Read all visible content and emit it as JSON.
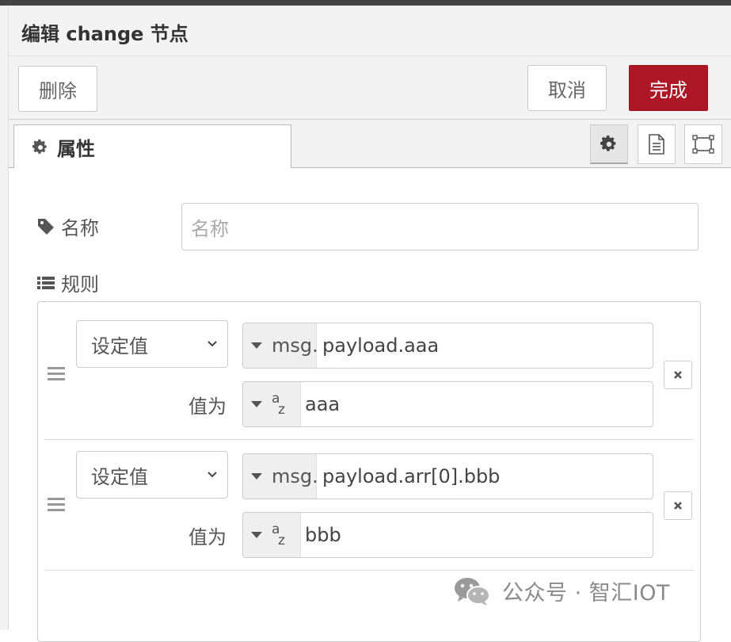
{
  "dialog": {
    "title": "编辑 change 节点"
  },
  "toolbar": {
    "delete_label": "删除",
    "cancel_label": "取消",
    "done_label": "完成"
  },
  "tabs": {
    "properties_label": "属性"
  },
  "form": {
    "name_label": "名称",
    "name_placeholder": "名称",
    "name_value": "",
    "rules_label": "规则"
  },
  "rules": [
    {
      "action": "设定值",
      "target_type": "msg.",
      "target_value": "payload.aaa",
      "value_label": "值为",
      "value_type": "string",
      "value": "aaa"
    },
    {
      "action": "设定值",
      "target_type": "msg.",
      "target_value": "payload.arr[0].bbb",
      "value_label": "值为",
      "value_type": "string",
      "value": "bbb"
    }
  ],
  "string_type_icon": {
    "a": "a",
    "z": "z"
  },
  "watermark": {
    "text": "公众号 · 智汇IOT"
  },
  "colors": {
    "done_button": "#ad1625",
    "panel_bg": "#f3f3f3"
  }
}
